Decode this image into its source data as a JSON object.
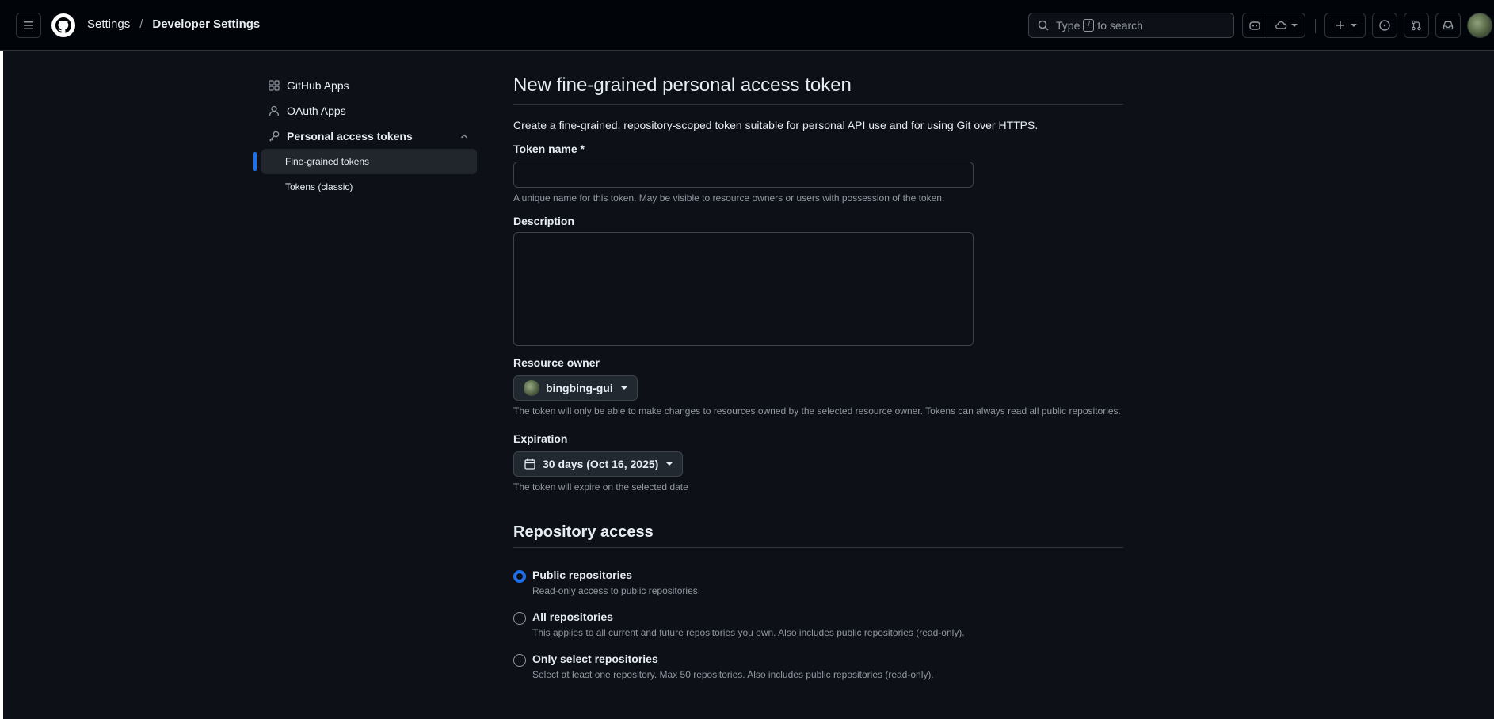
{
  "header": {
    "breadcrumb": [
      "Settings",
      "Developer Settings"
    ],
    "search": {
      "prefix": "Type",
      "key": "/",
      "suffix": "to search"
    }
  },
  "sidebar": {
    "items": [
      {
        "label": "GitHub Apps",
        "icon": "apps-icon"
      },
      {
        "label": "OAuth Apps",
        "icon": "person-icon"
      },
      {
        "label": "Personal access tokens",
        "icon": "key-icon"
      }
    ],
    "sub_items": [
      {
        "label": "Fine-grained tokens",
        "active": true
      },
      {
        "label": "Tokens (classic)",
        "active": false
      }
    ]
  },
  "main": {
    "title": "New fine-grained personal access token",
    "intro": "Create a fine-grained, repository-scoped token suitable for personal API use and for using Git over HTTPS.",
    "token_name": {
      "label": "Token name *",
      "value": "",
      "note": "A unique name for this token. May be visible to resource owners or users with possession of the token."
    },
    "description": {
      "label": "Description",
      "value": ""
    },
    "resource_owner": {
      "label": "Resource owner",
      "selected": "bingbing-gui",
      "note": "The token will only be able to make changes to resources owned by the selected resource owner. Tokens can always read all public repositories."
    },
    "expiration": {
      "label": "Expiration",
      "selected": "30 days (Oct 16, 2025)",
      "note": "The token will expire on the selected date"
    },
    "repository_access": {
      "title": "Repository access",
      "options": [
        {
          "label": "Public repositories",
          "note": "Read-only access to public repositories.",
          "checked": true
        },
        {
          "label": "All repositories",
          "note": "This applies to all current and future repositories you own. Also includes public repositories (read-only).",
          "checked": false
        },
        {
          "label": "Only select repositories",
          "note": "Select at least one repository. Max 50 repositories. Also includes public repositories (read-only).",
          "checked": false
        }
      ]
    }
  },
  "colors": {
    "accent": "#1f6feb",
    "background": "#0d1117",
    "header_bg": "#010409",
    "border": "#30363d",
    "muted_text": "#9198a1"
  }
}
